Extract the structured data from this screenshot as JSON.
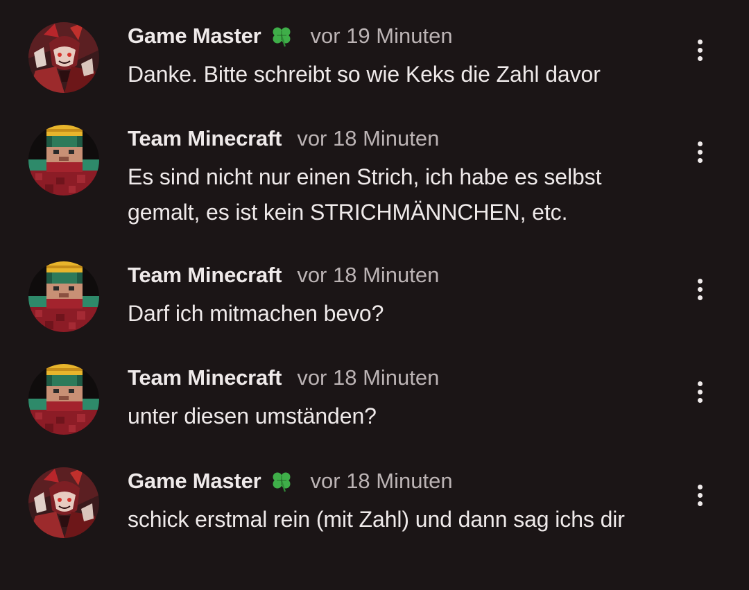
{
  "comments": [
    {
      "author": "Game Master",
      "badge_icon": "four-leaf-clover-icon",
      "time": "vor 19 Minuten",
      "text": "Danke. Bitte schreibt so wie Keks die Zahl davor",
      "avatar": "game-master-avatar"
    },
    {
      "author": "Team Minecraft",
      "time": "vor 18 Minuten",
      "text": "Es sind nicht nur einen Strich, ich habe es selbst gemalt, es ist kein STRICHMÄNNCHEN, etc.",
      "avatar": "team-minecraft-avatar"
    },
    {
      "author": "Team Minecraft",
      "time": "vor 18 Minuten",
      "text": "Darf ich mitmachen bevo?",
      "avatar": "team-minecraft-avatar"
    },
    {
      "author": "Team Minecraft",
      "time": "vor 18 Minuten",
      "text": "unter diesen umständen?",
      "avatar": "team-minecraft-avatar"
    },
    {
      "author": "Game Master",
      "badge_icon": "four-leaf-clover-icon",
      "time": "vor 18 Minuten",
      "text": "schick erstmal rein (mit Zahl) und dann sag ichs dir",
      "avatar": "game-master-avatar"
    }
  ],
  "colors": {
    "background": "#1b1516",
    "text": "#efeaea",
    "secondary_text": "#bcb4b5",
    "clover": "#3fae49"
  },
  "more_options_icon": "three-dots-vertical-icon"
}
